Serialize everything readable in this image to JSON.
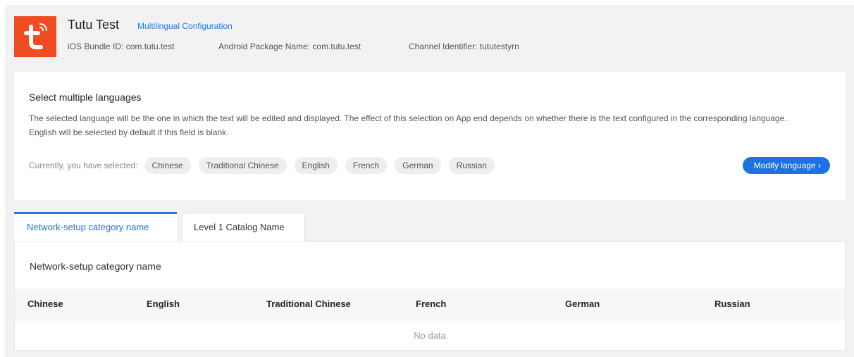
{
  "app": {
    "icon": "tuya-logo-icon",
    "icon_color": "#f04c24",
    "name": "Tutu Test",
    "config_link": "Multilingual Configuration",
    "ios_bundle": "iOS Bundle ID: com.tutu.test",
    "android_package": "Android Package Name: com.tutu.test",
    "channel": "Channel Identifier: tututestyrn"
  },
  "language_card": {
    "title": "Select multiple languages",
    "description": "The selected language will be the one in which the text will be edited and displayed. The effect of this selection on App end depends on whether there is the text configured in the corresponding language. English will be selected by default if this field is blank.",
    "selected_label": "Currently, you have selected:",
    "selected_languages": [
      "Chinese",
      "Traditional Chinese",
      "English",
      "French",
      "German",
      "Russian"
    ],
    "modify_button": "Modify language",
    "modify_icon": "chevron-right-icon",
    "accent_color": "#1c72e0"
  },
  "tabs": [
    {
      "label": "Network-setup category name",
      "active": true
    },
    {
      "label": "Level 1 Catalog Name",
      "active": false
    }
  ],
  "table": {
    "title": "Network-setup category name",
    "columns": [
      "Chinese",
      "English",
      "Traditional Chinese",
      "French",
      "German",
      "Russian"
    ],
    "rows": [],
    "empty_text": "No data"
  }
}
